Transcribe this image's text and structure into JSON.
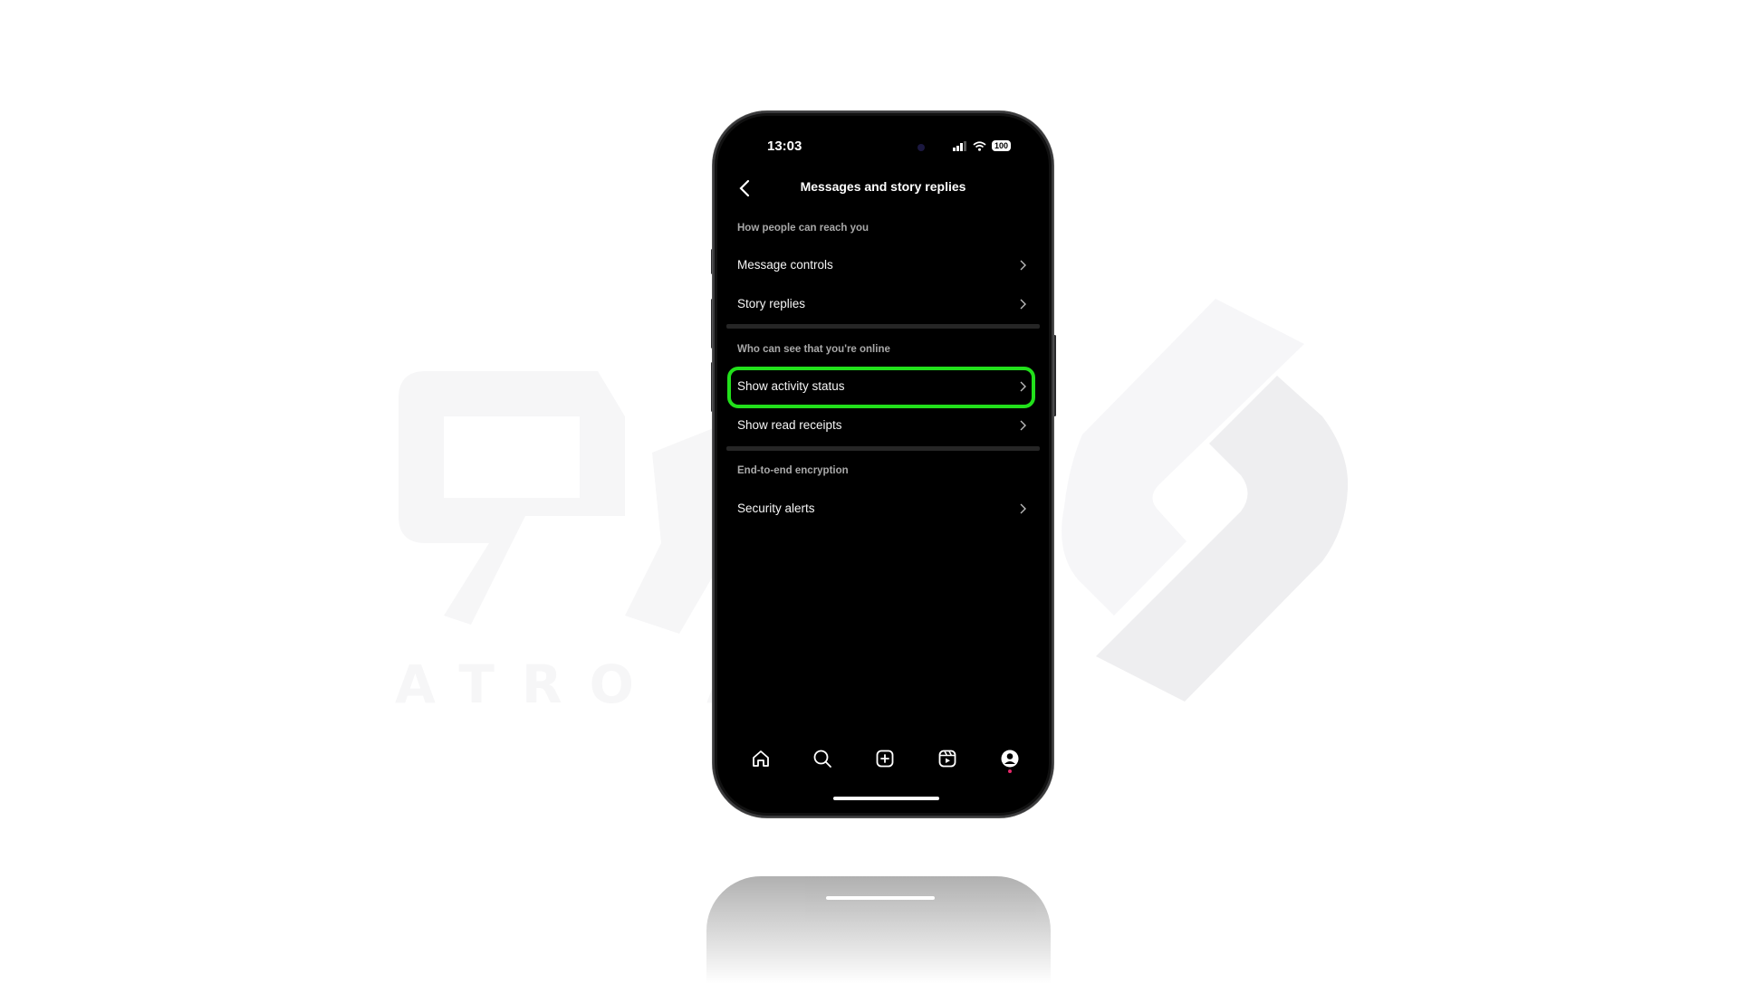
{
  "watermark": {
    "text": "ATRO AC",
    "colors": {
      "light": "#f6f6f7",
      "mid": "#eeeef0"
    }
  },
  "status_bar": {
    "time": "13:03",
    "battery": "100"
  },
  "header": {
    "title": "Messages and story replies",
    "back_icon": "chevron-left-icon"
  },
  "sections": [
    {
      "heading": "How people can reach you",
      "items": [
        {
          "label": "Message controls"
        },
        {
          "label": "Story replies"
        }
      ]
    },
    {
      "heading": "Who can see that you're online",
      "items": [
        {
          "label": "Show activity status",
          "highlighted": true
        },
        {
          "label": "Show read receipts"
        }
      ]
    },
    {
      "heading": "End-to-end encryption",
      "items": [
        {
          "label": "Security alerts"
        }
      ]
    }
  ],
  "highlight_color": "#22e01b",
  "tab_bar": {
    "tabs": [
      {
        "name": "home",
        "icon": "home-icon"
      },
      {
        "name": "search",
        "icon": "search-icon"
      },
      {
        "name": "create",
        "icon": "plus-square-icon"
      },
      {
        "name": "reels",
        "icon": "reels-icon"
      },
      {
        "name": "profile",
        "icon": "profile-icon",
        "notification": true
      }
    ],
    "notification_color": "#e6286a"
  }
}
